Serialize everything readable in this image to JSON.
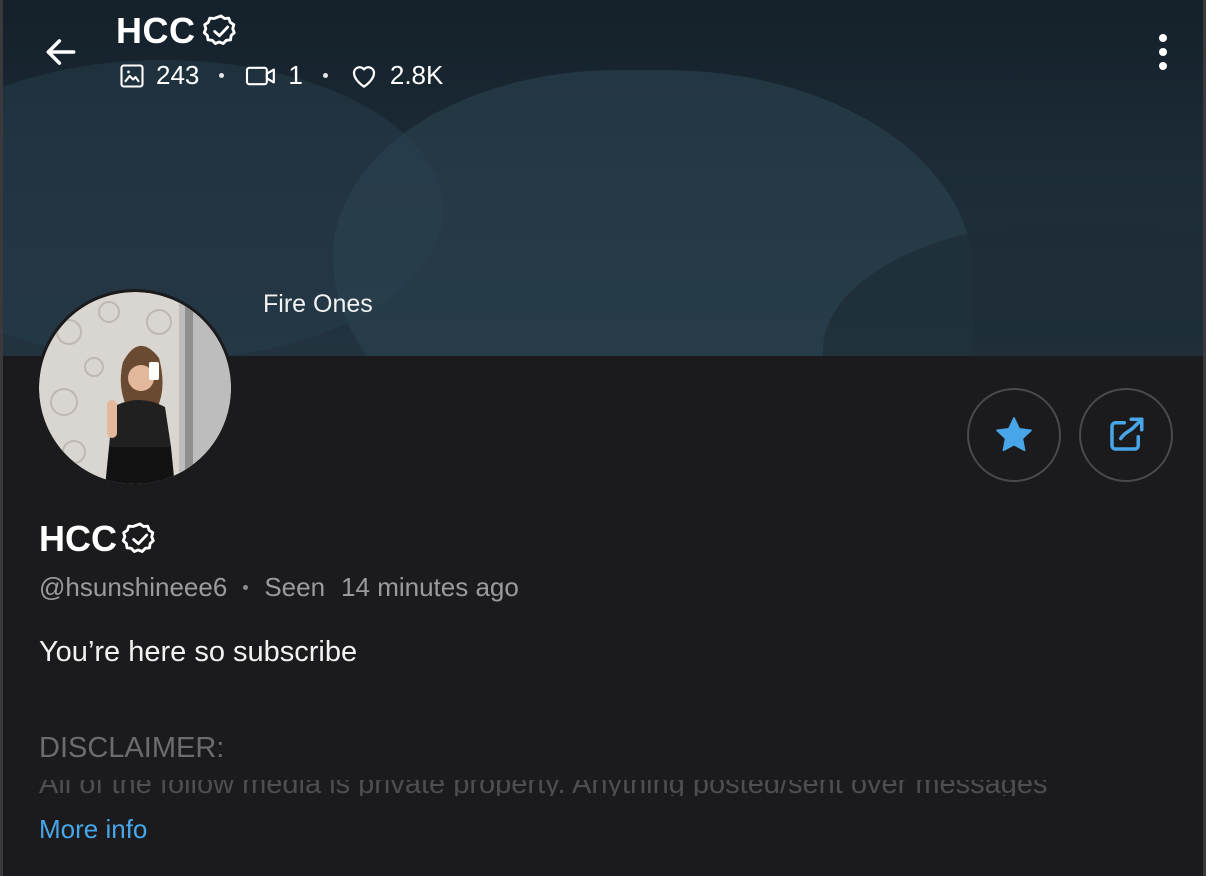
{
  "header": {
    "title": "HCC",
    "stats": {
      "photos": "243",
      "videos": "1",
      "likes": "2.8K"
    },
    "icons": {
      "back": "arrow-left-icon",
      "more": "more-vertical-icon",
      "photos": "image-icon",
      "videos": "video-icon",
      "likes": "heart-icon",
      "verified": "verified-badge-icon"
    }
  },
  "banner": {
    "caption": "Fire Ones"
  },
  "actions": {
    "favorite_icon": "star-icon",
    "share_icon": "share-icon",
    "accent_color": "#48a6e8"
  },
  "profile": {
    "name": "HCC",
    "handle": "@hsunshineee6",
    "seen_label": "Seen",
    "seen_time": "14 minutes ago",
    "bio": "You’re here so subscribe",
    "disclaimer_heading": "DISCLAIMER:",
    "disclaimer_text": "All of the follow media is private property. Anything posted/sent over messages",
    "more_info": "More info"
  }
}
